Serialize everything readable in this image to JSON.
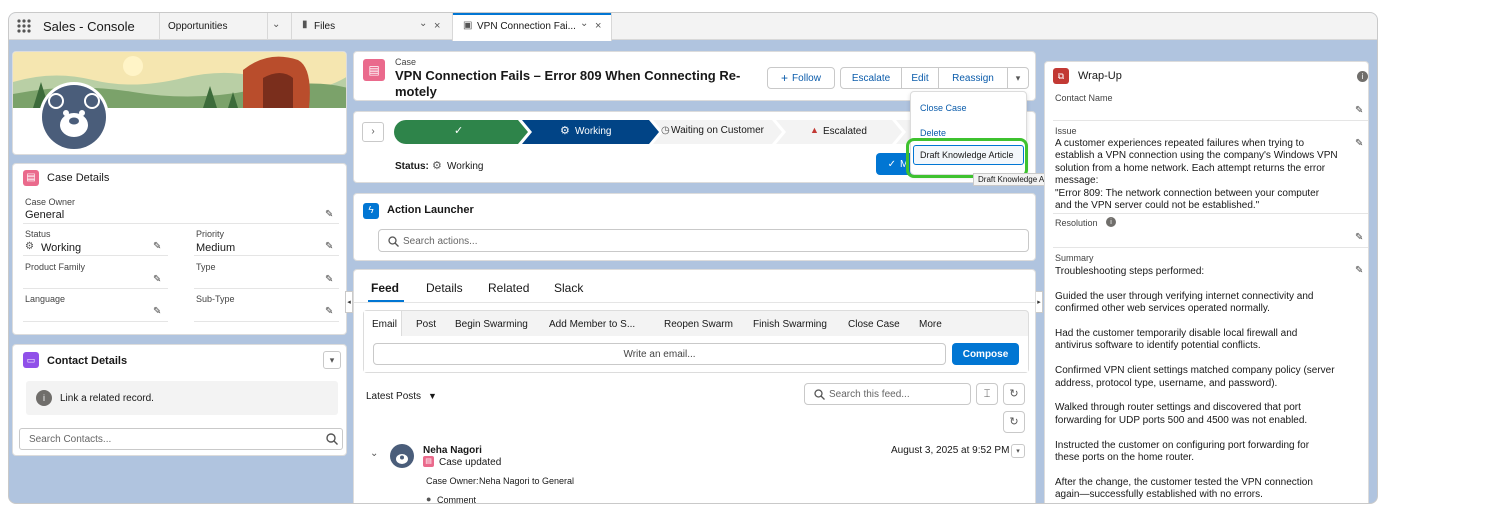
{
  "app": {
    "title": "Sales - Console"
  },
  "tabs": [
    {
      "label": "Opportunities"
    },
    {
      "label": "Files"
    },
    {
      "label": "VPN Connection Fai..."
    }
  ],
  "case_header": {
    "type_label": "Case",
    "title_line1": "VPN Connection Fails – Error 809 When Connecting Re-",
    "title_line2": "motely",
    "actions": {
      "follow": "Follow",
      "escalate": "Escalate",
      "edit": "Edit",
      "reassign": "Reassign"
    }
  },
  "dropdown_menu": {
    "items": [
      "Close Case",
      "Delete",
      "Draft Knowledge Article"
    ],
    "tooltip": "Draft Knowledge Article"
  },
  "path": {
    "steps": [
      "",
      "Working",
      "Waiting on Customer",
      "Escalated"
    ],
    "status_label": "Status:",
    "status_value": "Working",
    "mark_button": "M"
  },
  "case_details": {
    "title": "Case Details",
    "fields": {
      "case_owner_label": "Case Owner",
      "case_owner_value": "General",
      "status_label": "Status",
      "status_value": "Working",
      "priority_label": "Priority",
      "priority_value": "Medium",
      "product_family_label": "Product Family",
      "type_label": "Type",
      "language_label": "Language",
      "sub_type_label": "Sub-Type"
    }
  },
  "contact_details": {
    "title": "Contact Details",
    "info": "Link a related record.",
    "search_placeholder": "Search Contacts..."
  },
  "action_launcher": {
    "title": "Action Launcher",
    "search_placeholder": "Search actions..."
  },
  "feed": {
    "tabs": [
      "Feed",
      "Details",
      "Related",
      "Slack"
    ],
    "publisher_tabs": [
      "Email",
      "Post",
      "Begin Swarming",
      "Add Member to S...",
      "Reopen Swarm",
      "Finish Swarming",
      "Close Case",
      "More"
    ],
    "email_placeholder": "Write an email...",
    "compose": "Compose",
    "sort_label": "Latest Posts",
    "search_placeholder": "Search this feed...",
    "post": {
      "author": "Neha Nagori",
      "action": "Case updated",
      "timestamp": "August 3, 2025 at 9:52 PM",
      "detail_label": "Case Owner:",
      "detail_value": "Neha Nagori to General",
      "comment": "Comment"
    }
  },
  "wrapup": {
    "title": "Wrap-Up",
    "contact_name_label": "Contact Name",
    "issue_label": "Issue",
    "issue_lines": [
      "A customer experiences repeated failures when trying to",
      "establish a VPN connection using the company's Windows VPN",
      "solution from a home network. Each attempt returns the error",
      "message:",
      "\"Error 809: The network connection between your computer",
      "and the VPN server could not be established.\""
    ],
    "resolution_label": "Resolution",
    "summary_label": "Summary",
    "summary_paragraphs": [
      [
        "Troubleshooting steps performed:"
      ],
      [
        "Guided the user through verifying internet connectivity and",
        "confirmed other web services operated normally."
      ],
      [
        "Had the customer temporarily disable local firewall and",
        "antivirus software to identify potential conflicts."
      ],
      [
        "Confirmed VPN client settings matched company policy (server",
        "address, protocol type, username, and password)."
      ],
      [
        "Walked through router settings and discovered that port",
        "forwarding for UDP ports 500 and 4500 was not enabled."
      ],
      [
        "Instructed the customer on configuring port forwarding for",
        "these ports on the home router."
      ],
      [
        "After the change, the customer tested the VPN connection",
        "again—successfully established with no errors."
      ]
    ]
  },
  "colors": {
    "brand": "#0176d3",
    "path_complete": "#2e844a",
    "path_current": "#014486",
    "highlight": "#3ec22f",
    "bg": "#b0c4df"
  }
}
